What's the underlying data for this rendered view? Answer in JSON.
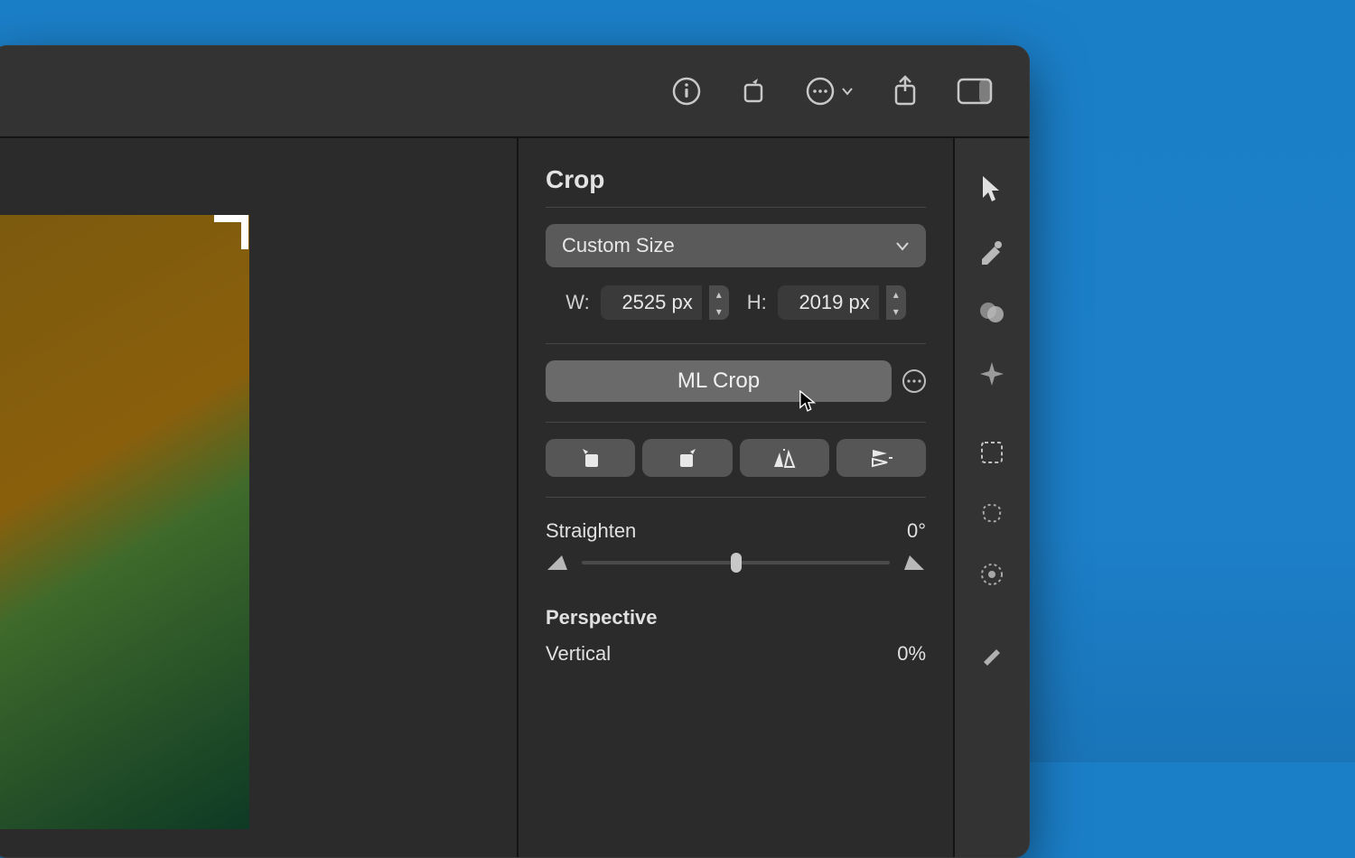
{
  "panel": {
    "title": "Crop",
    "size_mode": "Custom Size",
    "width_label": "W:",
    "width_value": "2525 px",
    "height_label": "H:",
    "height_value": "2019 px",
    "ml_crop_label": "ML Crop",
    "straighten_label": "Straighten",
    "straighten_value": "0°",
    "perspective_label": "Perspective",
    "perspective_vertical_label": "Vertical",
    "perspective_vertical_value": "0%"
  },
  "toolbar_icons": [
    "info",
    "rotate",
    "more",
    "share",
    "sidebar"
  ],
  "side_tools": [
    "arrow",
    "styles",
    "adjust",
    "effects",
    "select-rect",
    "select-free",
    "select-color",
    "repair"
  ]
}
